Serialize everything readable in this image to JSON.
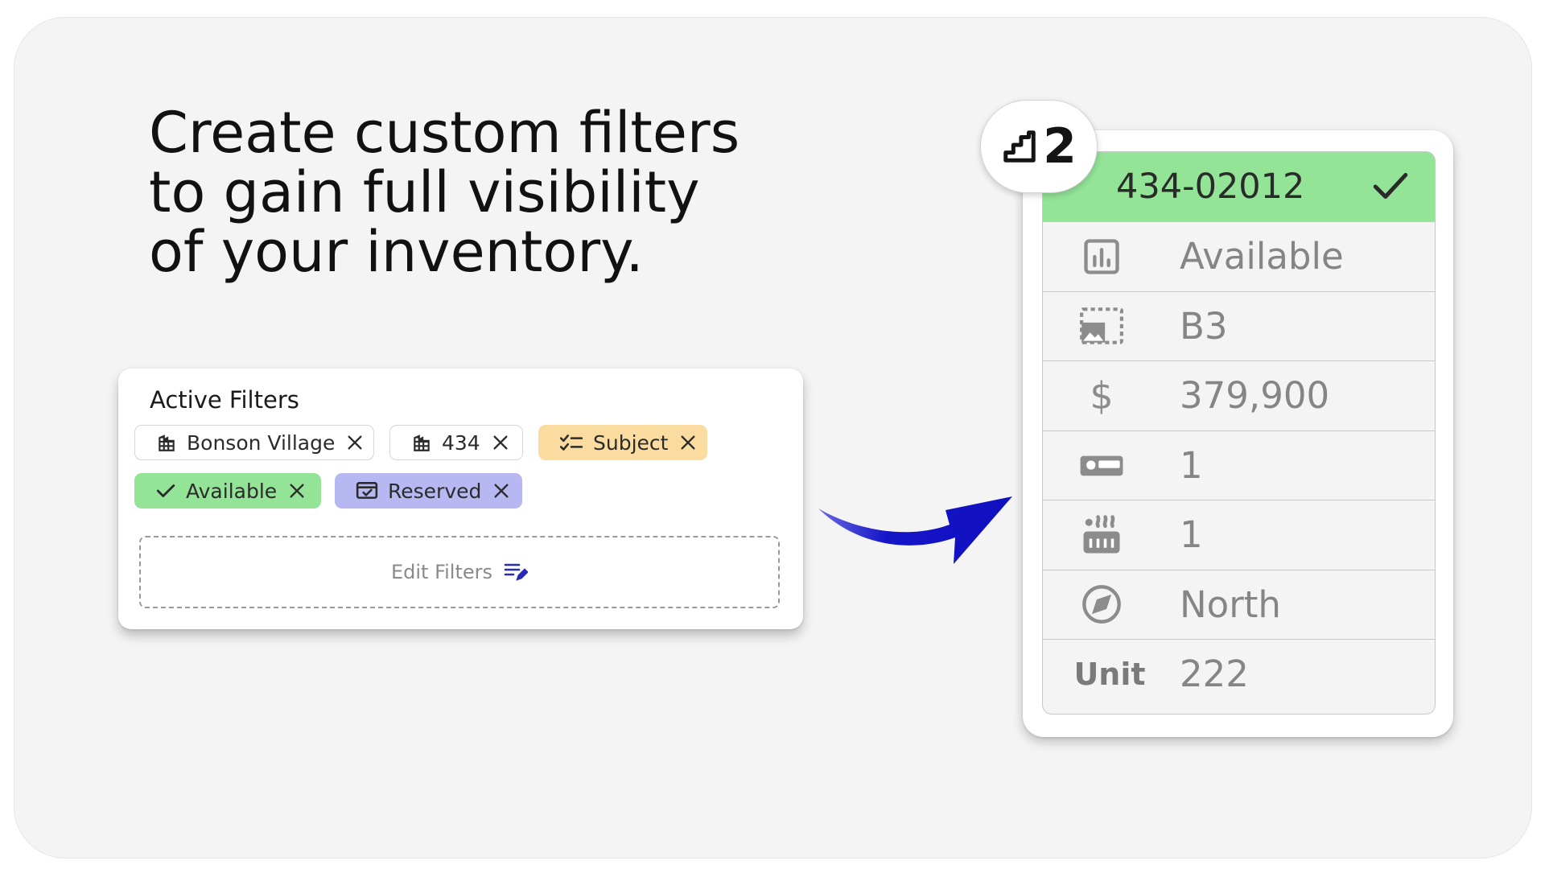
{
  "headline": {
    "line1": "Create custom filters",
    "line2": "to gain full visibility",
    "line3": "of your inventory."
  },
  "filters": {
    "title": "Active Filters",
    "chips": [
      {
        "label": "Bonson Village",
        "icon": "building-icon",
        "color": "#ffffff"
      },
      {
        "label": "434",
        "icon": "building-icon",
        "color": "#ffffff"
      },
      {
        "label": "Subject",
        "icon": "checklist-icon",
        "color": "#fbdca0"
      },
      {
        "label": "Available",
        "icon": "check-icon",
        "color": "#93e497"
      },
      {
        "label": "Reserved",
        "icon": "card-check-icon",
        "color": "#b7b7f2"
      }
    ],
    "edit_label": "Edit Filters",
    "edit_icon": "edit-list-icon",
    "accent_color": "#2a2ab8"
  },
  "unit_card": {
    "floor": "2",
    "floor_icon": "stairs-icon",
    "unit_id": "434-02012",
    "header_color": "#93e497",
    "rows": [
      {
        "icon": "chart-icon",
        "value": "Available"
      },
      {
        "icon": "floorplan-icon",
        "value": "B3"
      },
      {
        "icon": "dollar-icon",
        "value": "379,900"
      },
      {
        "icon": "bed-icon",
        "value": "1"
      },
      {
        "icon": "bath-icon",
        "value": "1"
      },
      {
        "icon": "compass-icon",
        "value": "North"
      },
      {
        "label": "Unit",
        "value": "222"
      }
    ]
  }
}
